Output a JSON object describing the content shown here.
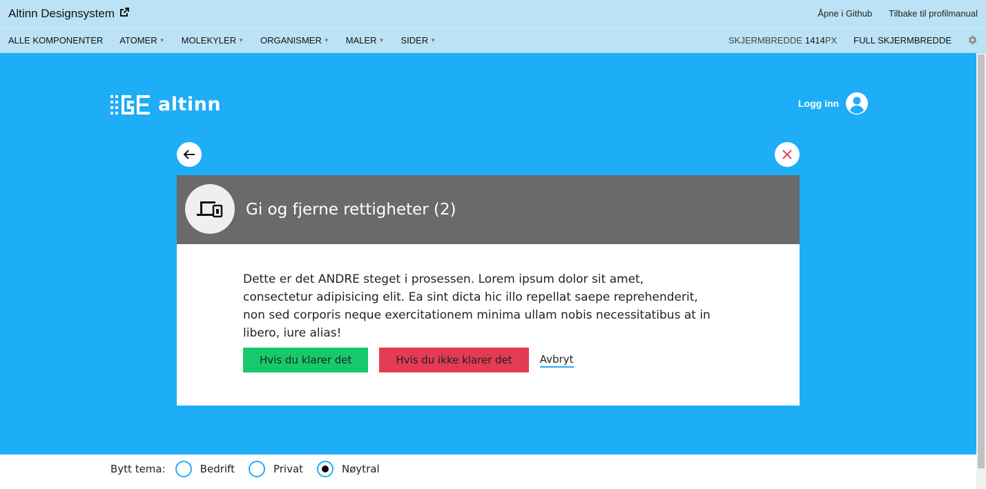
{
  "topbar": {
    "title": "Altinn Designsystem",
    "links": [
      "Åpne i Github",
      "Tilbake til profilmanual"
    ]
  },
  "nav": {
    "items": [
      "ALLE KOMPONENTER",
      "ATOMER",
      "MOLEKYLER",
      "ORGANISMER",
      "MALER",
      "SIDER"
    ],
    "width_label": "SKJERMBREDDE",
    "width_value": "1414",
    "width_unit": "PX",
    "full_width": "FULL SKJERMBREDDE"
  },
  "header": {
    "logo_text": "altinn",
    "login_label": "Logg inn"
  },
  "modal": {
    "title": "Gi og fjerne rettigheter (2)",
    "body": "Dette er det ANDRE steget i prosessen. Lorem ipsum dolor sit amet, consectetur adipisicing elit. Ea sint dicta hic illo repellat saepe reprehenderit, non sed corporis neque exercitationem minima ullam nobis necessitatibus at in libero, iure alias!",
    "primary_button": "Hvis du klarer det",
    "danger_button": "Hvis du ikke klarer det",
    "cancel_link": "Avbryt"
  },
  "theme": {
    "label": "Bytt tema:",
    "options": [
      "Bedrift",
      "Privat",
      "Nøytral"
    ],
    "selected": "Nøytral"
  },
  "colors": {
    "stage": "#1eadf7",
    "topbar": "#bbe3f5",
    "modal_header": "#6a6a6a",
    "success": "#17c96b",
    "danger": "#e23b53"
  }
}
